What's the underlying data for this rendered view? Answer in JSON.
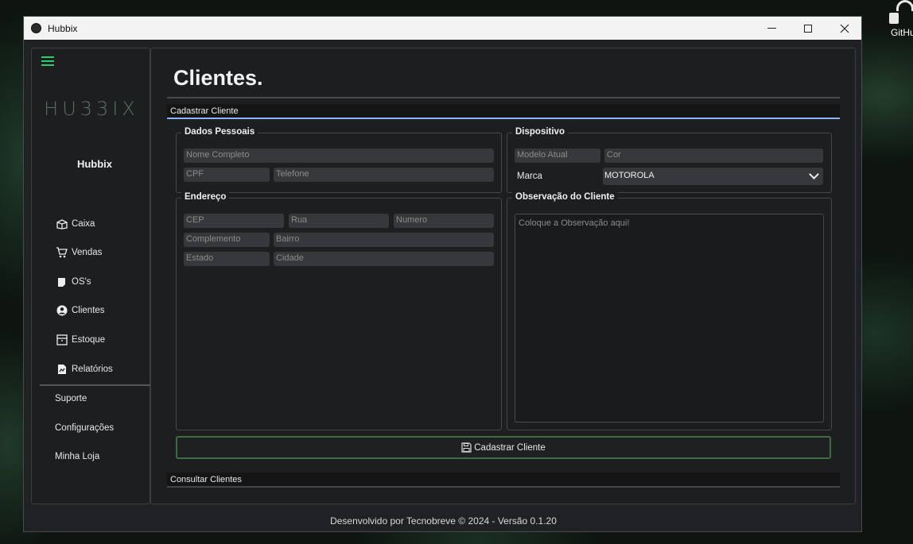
{
  "desktop": {
    "icon_label": "GitHu"
  },
  "window": {
    "title": "Hubbix",
    "controls": {
      "minimize": "minimize-icon",
      "maximize": "maximize-icon",
      "close": "close-icon"
    }
  },
  "sidebar": {
    "logo": "HU33IX",
    "brand": "Hubbix",
    "items": [
      {
        "label": "Caixa",
        "icon": "cash-box-icon"
      },
      {
        "label": "Vendas",
        "icon": "cart-icon"
      },
      {
        "label": "OS's",
        "icon": "document-icon"
      },
      {
        "label": "Clientes",
        "icon": "user-circle-icon"
      },
      {
        "label": "Estoque",
        "icon": "box-icon"
      },
      {
        "label": "Relatórios",
        "icon": "report-icon"
      }
    ],
    "bottom_items": [
      {
        "label": "Suporte"
      },
      {
        "label": "Configurações"
      },
      {
        "label": "Minha Loja"
      }
    ]
  },
  "main": {
    "title": "Clientes.",
    "register_section": "Cadastrar Cliente",
    "personal": {
      "title": "Dados Pessoais",
      "name_placeholder": "Nome Completo",
      "cpf_placeholder": "CPF",
      "phone_placeholder": "Telefone"
    },
    "device": {
      "title": "Dispositivo",
      "model_placeholder": "Modelo Atual",
      "color_placeholder": "Cor",
      "brand_label": "Marca",
      "brand_value": "MOTOROLA"
    },
    "address": {
      "title": "Endereço",
      "cep": "CEP",
      "street": "Rua",
      "number": "Numero",
      "complement": "Complemento",
      "district": "Bairro",
      "state": "Estado",
      "city": "Cidade"
    },
    "notes": {
      "title": "Observação do Cliente",
      "placeholder": "Coloque a Observação aqui!"
    },
    "submit_label": "Cadastrar Cliente",
    "consult_section": "Consultar Clientes"
  },
  "footer": "Desenvolvido por Tecnobreve © 2024 - Versão 0.1.20",
  "colors": {
    "accent_green": "#2ecc71",
    "active_tab": "#8ab4f8",
    "button_border": "#3e6b44"
  }
}
